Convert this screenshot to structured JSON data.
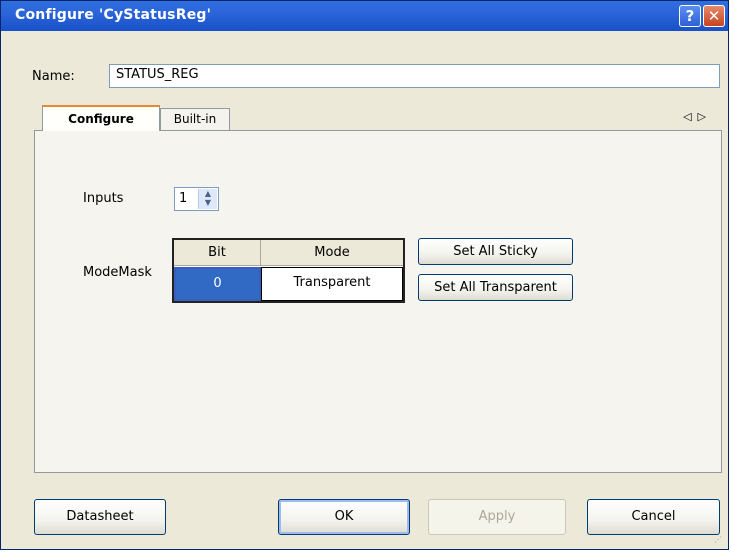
{
  "window": {
    "title": "Configure 'CyStatusReg'",
    "help_icon": "?",
    "close_icon": "✕"
  },
  "name_field": {
    "label": "Name:",
    "value": "STATUS_REG"
  },
  "tabs": [
    {
      "label": "Configure",
      "active": true
    },
    {
      "label": "Built-in",
      "active": false
    }
  ],
  "tab_nav": {
    "left": "◁",
    "right": "▷"
  },
  "configure": {
    "inputs_label": "Inputs",
    "inputs_value": "1",
    "modemask_label": "ModeMask",
    "grid": {
      "columns": [
        "Bit",
        "Mode"
      ],
      "rows": [
        {
          "bit": "0",
          "mode": "Transparent"
        }
      ]
    },
    "set_all_sticky": "Set All Sticky",
    "set_all_transparent": "Set All Transparent"
  },
  "buttons": {
    "datasheet": "Datasheet",
    "ok": "OK",
    "apply": "Apply",
    "cancel": "Cancel"
  },
  "colors": {
    "title_bar": "#2a63d8",
    "selected_cell": "#316ac5",
    "dialog_bg": "#ece9d8"
  }
}
